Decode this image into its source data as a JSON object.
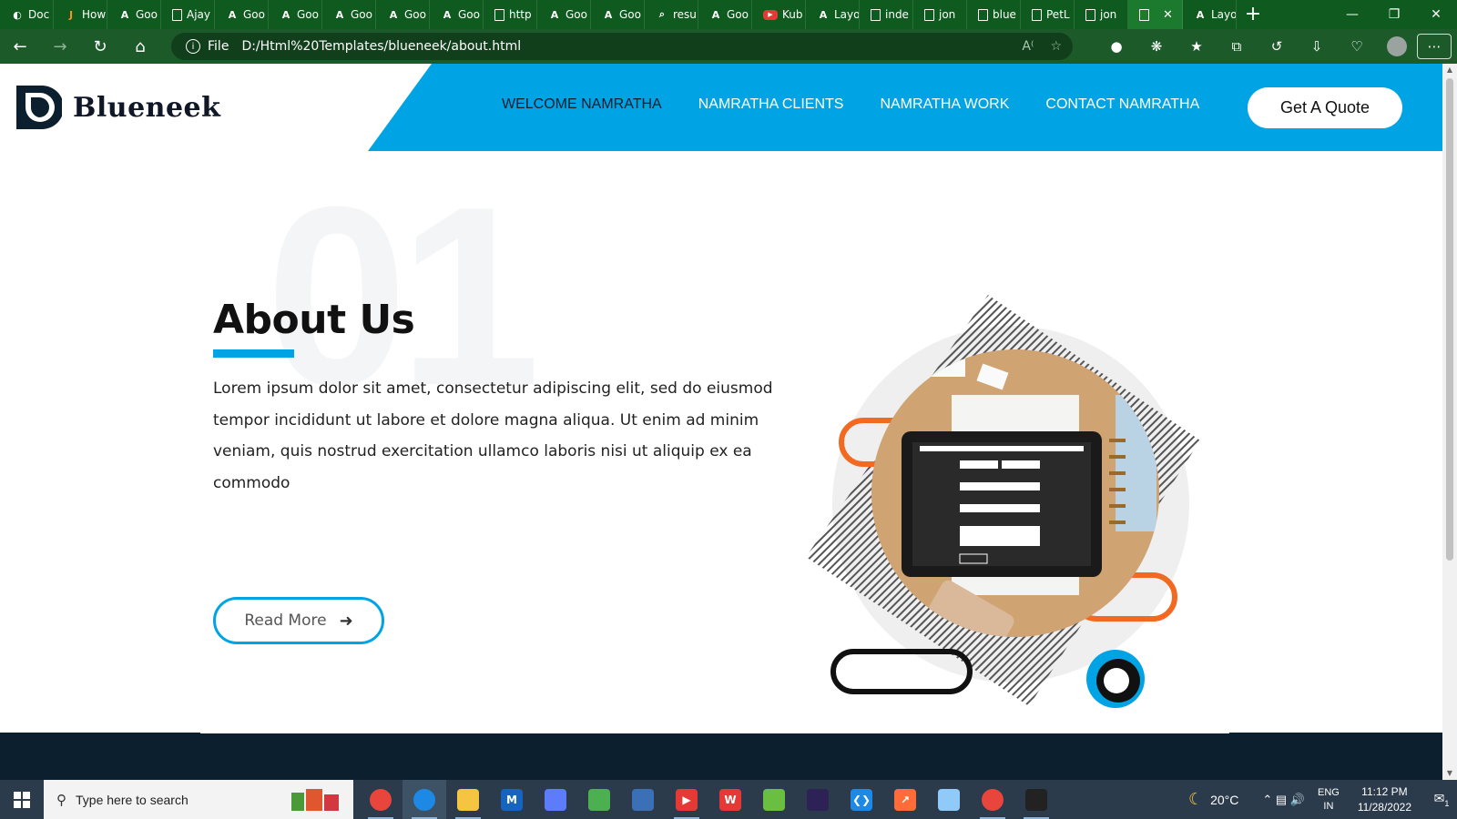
{
  "browser": {
    "tabs": [
      {
        "label": "Doc",
        "favicon": "doc-icon"
      },
      {
        "label": "How",
        "favicon": "javatpoint-icon"
      },
      {
        "label": "Goo",
        "favicon": "a-icon"
      },
      {
        "label": "Ajay",
        "favicon": "page-icon"
      },
      {
        "label": "Goo",
        "favicon": "a-icon"
      },
      {
        "label": "Goo",
        "favicon": "a-icon"
      },
      {
        "label": "Goo",
        "favicon": "a-icon"
      },
      {
        "label": "Goo",
        "favicon": "a-icon"
      },
      {
        "label": "Goo",
        "favicon": "a-icon"
      },
      {
        "label": "http",
        "favicon": "page-icon"
      },
      {
        "label": "Goo",
        "favicon": "a-icon"
      },
      {
        "label": "Goo",
        "favicon": "a-icon"
      },
      {
        "label": "resu",
        "favicon": "search-icon"
      },
      {
        "label": "Goo",
        "favicon": "a-icon"
      },
      {
        "label": "Kub",
        "favicon": "youtube-icon"
      },
      {
        "label": "Layo",
        "favicon": "a-icon"
      },
      {
        "label": "inde",
        "favicon": "page-icon"
      },
      {
        "label": "jon",
        "favicon": "page-icon"
      },
      {
        "label": "blue",
        "favicon": "page-icon"
      },
      {
        "label": "PetL",
        "favicon": "page-icon"
      },
      {
        "label": "jon",
        "favicon": "page-icon"
      }
    ],
    "active_tab_close": "✕",
    "after_tab": {
      "label": "Layo",
      "favicon": "a-icon"
    },
    "new_tab": "+",
    "url_scheme": "File",
    "url": "D:/Html%20Templates/blueneek/about.html",
    "theme_color": "#1c5a2a"
  },
  "site": {
    "logo_text": "Blueneek",
    "nav": [
      {
        "label": "WELCOME NAMRATHA",
        "current": true
      },
      {
        "label": "NAMRATHA CLIENTS",
        "current": false
      },
      {
        "label": "NAMRATHA WORK",
        "current": false
      },
      {
        "label": "CONTACT NAMRATHA",
        "current": false
      }
    ],
    "quote_button": "Get A Quote",
    "accent_color": "#00a4e4",
    "dark_color": "#0b1f2e"
  },
  "about": {
    "number": "01",
    "title": "About Us",
    "body": "Lorem ipsum dolor sit amet, consectetur adipiscing elit, sed do eiusmod tempor incididunt ut labore et dolore magna aliqua. Ut enim ad minim veniam, quis nostrud exercitation ullamco laboris nisi ut aliquip ex ea commodo",
    "read_more": "Read More"
  },
  "taskbar": {
    "search_placeholder": "Type here to search",
    "apps": [
      "chrome-icon",
      "edge-icon",
      "file-explorer-icon",
      "m-app-icon",
      "network-icon",
      "notepad-icon",
      "visual-studio-icon",
      "youtube-app-icon",
      "wps-icon",
      "spring-icon",
      "eclipse-icon",
      "vscode-icon",
      "postman-icon",
      "notes-icon",
      "chrome-profile-icon",
      "terminal-icon"
    ],
    "temperature": "20°C",
    "language_line1": "ENG",
    "language_line2": "IN",
    "time": "11:12 PM",
    "date": "11/28/2022",
    "notifications": "1"
  }
}
